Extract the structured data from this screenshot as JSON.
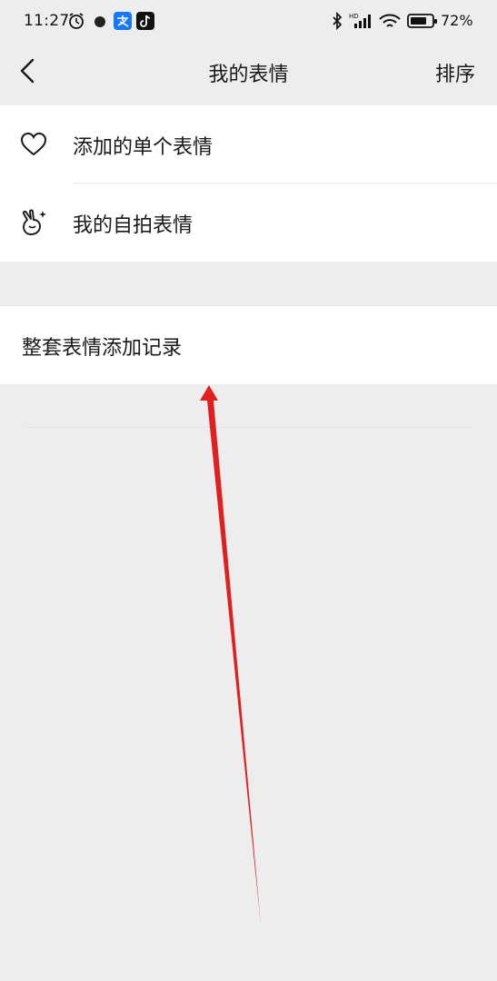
{
  "status_bar": {
    "time": "11:27",
    "battery": "72%",
    "left_icons": [
      "alarm-icon",
      "notification-dot-icon",
      "alipay-icon",
      "tiktok-icon"
    ],
    "right_icons": [
      "bluetooth-icon",
      "hd-signal-icon",
      "wifi-icon",
      "battery-icon"
    ]
  },
  "nav": {
    "title": "我的表情",
    "sort_label": "排序"
  },
  "menu": {
    "items": [
      {
        "label": "添加的单个表情",
        "icon": "heart-icon"
      },
      {
        "label": "我的自拍表情",
        "icon": "selfie-hand-icon"
      }
    ],
    "history_label": "整套表情添加记录"
  },
  "annotation": {
    "arrow_color": "#e02020"
  },
  "colors": {
    "background": "#ededed",
    "card": "#ffffff",
    "text": "#191919"
  }
}
